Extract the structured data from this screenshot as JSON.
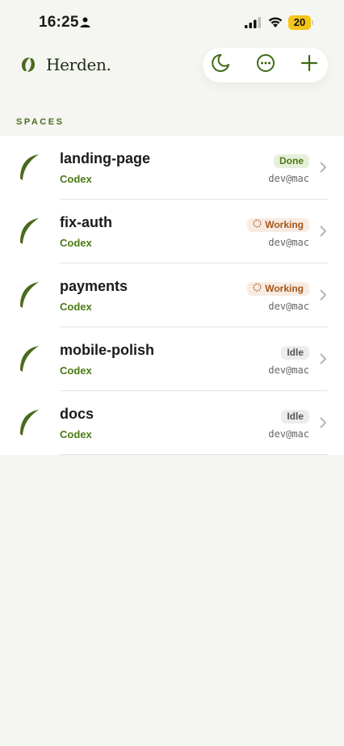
{
  "status_bar": {
    "time": "16:25",
    "battery": "20"
  },
  "header": {
    "app_title": "Herden.",
    "actions": [
      "moon-icon",
      "more-icon",
      "plus-icon"
    ]
  },
  "section_label": "SPACES",
  "colors": {
    "accent": "#4a7a14",
    "logo": "#4a6a1f",
    "working": "#a4571b"
  },
  "spaces": [
    {
      "name": "landing-page",
      "agent": "Codex",
      "status": "Done",
      "host": "dev@mac"
    },
    {
      "name": "fix-auth",
      "agent": "Codex",
      "status": "Working",
      "host": "dev@mac"
    },
    {
      "name": "payments",
      "agent": "Codex",
      "status": "Working",
      "host": "dev@mac"
    },
    {
      "name": "mobile-polish",
      "agent": "Codex",
      "status": "Idle",
      "host": "dev@mac"
    },
    {
      "name": "docs",
      "agent": "Codex",
      "status": "Idle",
      "host": "dev@mac"
    }
  ]
}
